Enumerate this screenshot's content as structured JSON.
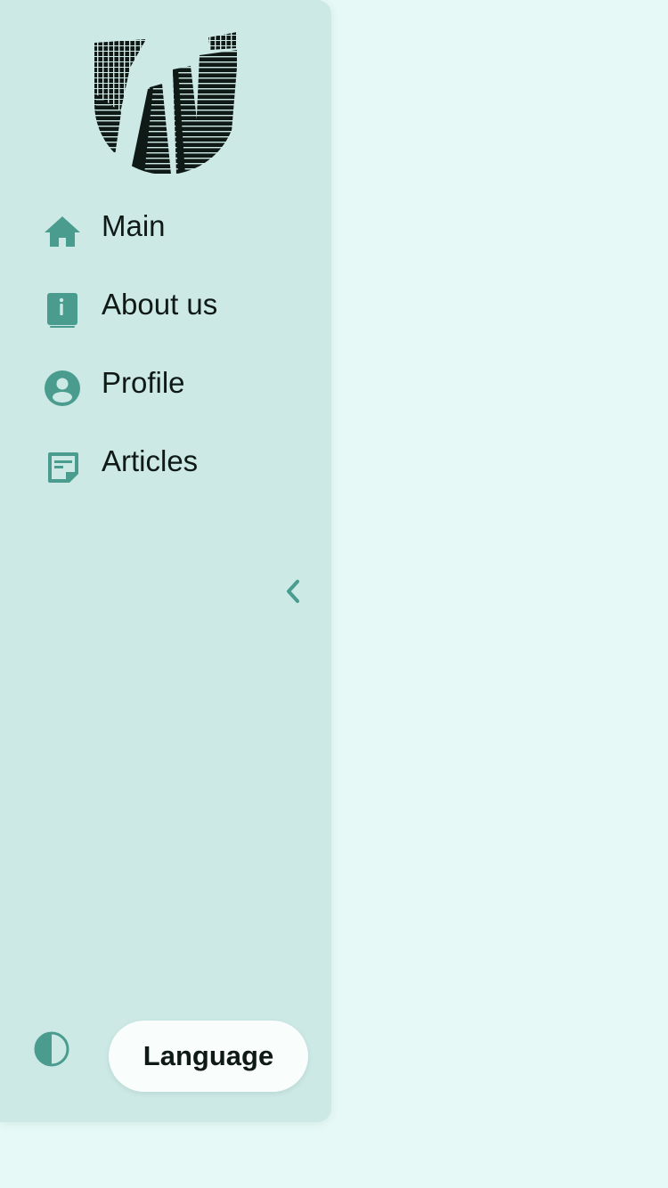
{
  "colors": {
    "page_background": "#e6f9f6",
    "sidebar_background": "#cde9e6",
    "icon_accent": "#4a9c8e",
    "text": "#0f1a16",
    "button_background": "#f9fdfc"
  },
  "logo": {
    "icon": "skyscrapers-logo"
  },
  "nav": {
    "items": [
      {
        "label": "Main",
        "icon": "home-icon"
      },
      {
        "label": "About us",
        "icon": "info-book-icon"
      },
      {
        "label": "Profile",
        "icon": "user-circle-icon"
      },
      {
        "label": "Articles",
        "icon": "article-icon"
      }
    ]
  },
  "sidebar": {
    "collapse_icon": "chevron-left-icon"
  },
  "footer": {
    "theme_icon": "contrast-icon",
    "language_label": "Language"
  }
}
